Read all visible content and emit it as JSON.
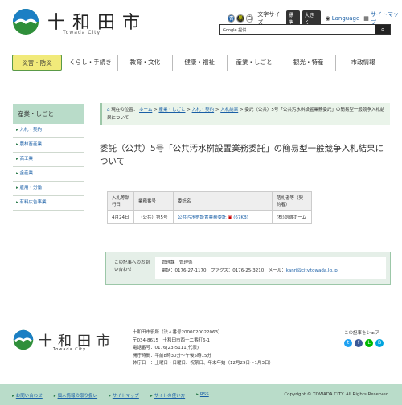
{
  "header": {
    "title": "十和田市",
    "subtitle": "Towada City",
    "color_label_blue": "青",
    "color_label_black": "黒",
    "color_label_white": "白",
    "font_size_label": "文字サイズ",
    "font_standard": "標準",
    "font_large": "大きく",
    "language": "Language",
    "sitemap": "サイトマップ",
    "search_placeholder": "Google 提供"
  },
  "gnav": [
    "災害・防災",
    "くらし・手続き",
    "教育・文化",
    "健康・福祉",
    "産業・しごと",
    "観光・特産",
    "市政情報"
  ],
  "sidebar": {
    "heading": "産業・しごと",
    "items": [
      "入札・契約",
      "農林畜産業",
      "商工業",
      "金産業",
      "雇用・労働",
      "有料広告事業"
    ]
  },
  "breadcrumb": {
    "prefix": "現在の位置：",
    "home": "ホーム",
    "l1": "産業・しごと",
    "l2": "入札・契約",
    "l3": "入札結果",
    "current": "委託（公共）5号「公共汚水桝設置業務委託」の簡易型一般競争入札結果について"
  },
  "page_title": "委託（公共）5号「公共汚水桝設置業務委託」の簡易型一般競争入札結果について",
  "table": {
    "h1": "入札等執行日",
    "h2": "業務番号",
    "h3": "委託名",
    "h4": "落札者等（契約者）",
    "date": "4月24日",
    "number": "（公共）第5号",
    "name": "公共汚水桝設置業務委託",
    "file": "(67KB)",
    "winner": "(株)創環ホーム"
  },
  "inquiry": {
    "label": "この記事へのお問い合わせ",
    "dept": "管理課　管理係",
    "tel": "電話：0176-27-1170　ファクス：0176-25-3210　メール：",
    "mail": "kanri@city.towada.lg.jp"
  },
  "footer": {
    "address": [
      "十和田市役所（法人番号2000020022063）",
      "〒034-8615　十和田市西十二番町6-1",
      "電話番号：0176(23)5111(代表)",
      "開庁時間：平前8時30分〜午後5時15分",
      "休庁日　：土曜日・日曜日、祝祭日、年末年始（12月29日〜1月3日）"
    ],
    "share_label": "この記事をシェア",
    "links": [
      "お問い合わせ",
      "個人情報の取り扱い",
      "サイトマップ",
      "サイトの使い方",
      "RSS"
    ],
    "copyright": "Copyright © TOWADA CITY. All Rights Reserved."
  },
  "colors": {
    "accent_green": "#b9dcc9",
    "gnav_active": "#f1ea7a",
    "link": "#1a5fa6"
  }
}
